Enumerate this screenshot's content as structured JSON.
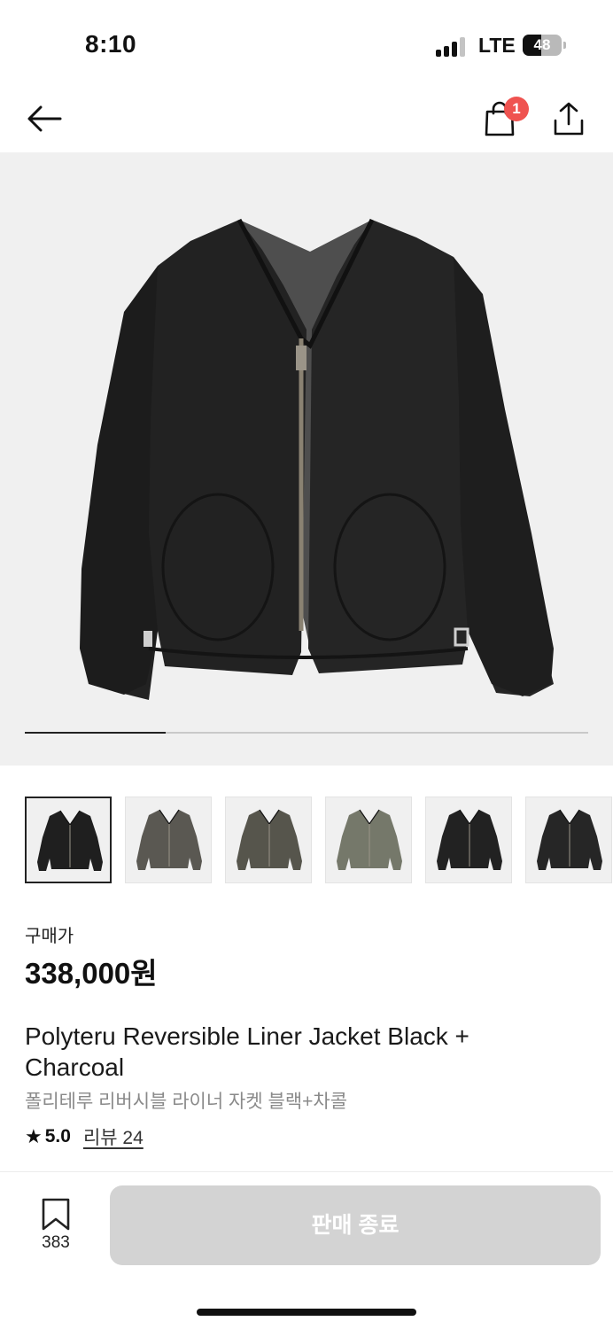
{
  "status_bar": {
    "time": "8:10",
    "network": "LTE",
    "battery_percent": "48",
    "battery_level": 0.48,
    "signal_bars": 3
  },
  "nav": {
    "back_icon": "arrow-left-icon",
    "cart_icon": "shopping-bag-icon",
    "cart_badge": "1",
    "share_icon": "share-icon"
  },
  "gallery": {
    "progress": 0.25,
    "thumbnails": [
      {
        "label": "black",
        "color": "#1f1f1f",
        "selected": true
      },
      {
        "label": "charcoal",
        "color": "#5a5852"
      },
      {
        "label": "olive charcoal",
        "color": "#56554c"
      },
      {
        "label": "khaki",
        "color": "#75786a"
      },
      {
        "label": "black quilted",
        "color": "#222222"
      },
      {
        "label": "black quilted 2",
        "color": "#262626"
      }
    ]
  },
  "product": {
    "price_label": "구매가",
    "price": "338,000원",
    "title_en": "Polyteru Reversible Liner Jacket Black + Charcoal",
    "title_ko": "폴리테루 리버시블 라이너 자켓 블랙+차콜",
    "star_icon": "★",
    "rating": "5.0",
    "review_link": "리뷰 24"
  },
  "bottom_bar": {
    "bookmark_icon": "bookmark-icon",
    "bookmark_count": "383",
    "action_label": "판매 종료"
  },
  "colors": {
    "badge": "#ef5350",
    "disabled_button": "#d3d3d3",
    "hero_background": "#f0f0f0"
  }
}
